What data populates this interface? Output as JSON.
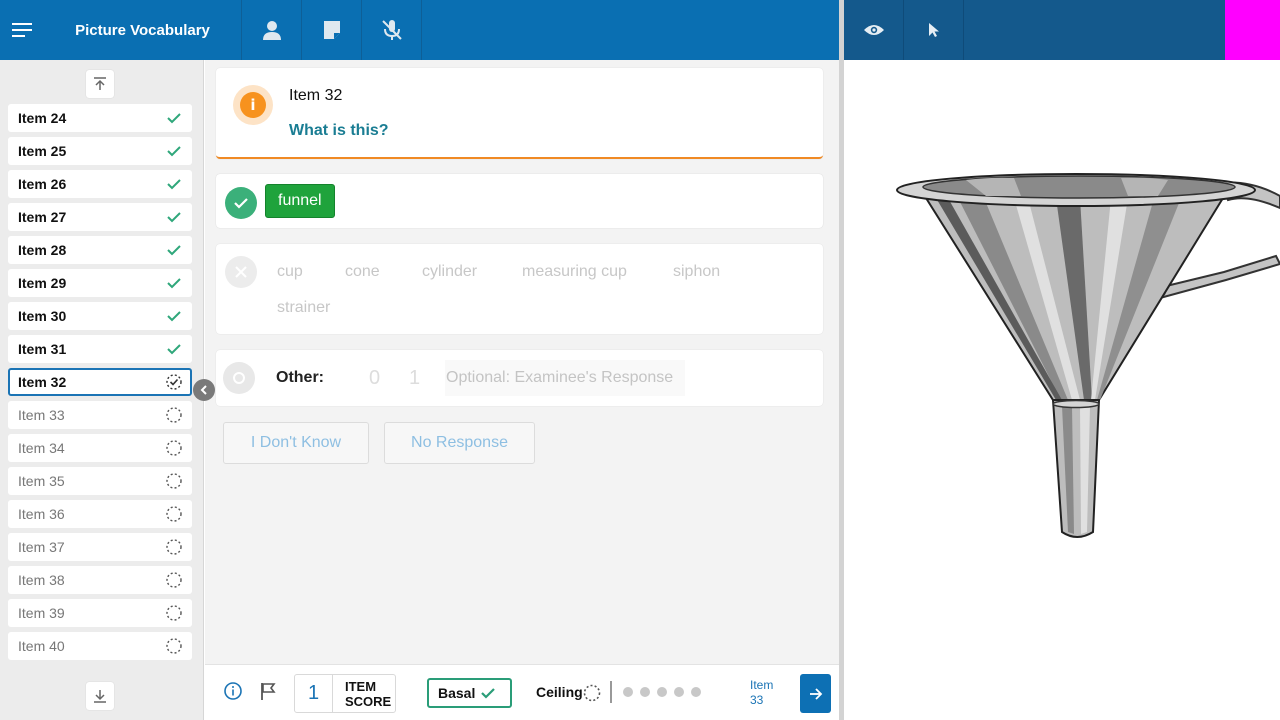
{
  "app": {
    "title": "Picture Vocabulary"
  },
  "sidebar": {
    "items": [
      {
        "label": "Item 24",
        "status": "done"
      },
      {
        "label": "Item 25",
        "status": "done"
      },
      {
        "label": "Item 26",
        "status": "done"
      },
      {
        "label": "Item 27",
        "status": "done"
      },
      {
        "label": "Item 28",
        "status": "done"
      },
      {
        "label": "Item 29",
        "status": "done"
      },
      {
        "label": "Item 30",
        "status": "done"
      },
      {
        "label": "Item 31",
        "status": "done"
      },
      {
        "label": "Item 32",
        "status": "current"
      },
      {
        "label": "Item 33",
        "status": "pending"
      },
      {
        "label": "Item 34",
        "status": "pending"
      },
      {
        "label": "Item 35",
        "status": "pending"
      },
      {
        "label": "Item 36",
        "status": "pending"
      },
      {
        "label": "Item 37",
        "status": "pending"
      },
      {
        "label": "Item 38",
        "status": "pending"
      },
      {
        "label": "Item 39",
        "status": "pending"
      },
      {
        "label": "Item 40",
        "status": "pending"
      }
    ]
  },
  "question": {
    "item_label": "Item 32",
    "prompt": "What is this?"
  },
  "answer": {
    "correct": "funnel"
  },
  "incorrect_options": [
    "cup",
    "cone",
    "cylinder",
    "measuring cup",
    "siphon",
    "strainer"
  ],
  "other": {
    "label": "Other:",
    "score_options": [
      "0",
      "1"
    ],
    "placeholder": "Optional: Examinee's Response"
  },
  "buttons": {
    "dont_know": "I Don't Know",
    "no_response": "No Response"
  },
  "bottom": {
    "item_score_value": "1",
    "item_score_label_1": "ITEM",
    "item_score_label_2": "SCORE",
    "basal_label": "Basal",
    "ceiling_label": "Ceiling",
    "next_item_line1": "Item",
    "next_item_line2": "33"
  },
  "colors": {
    "topbar": "#0a6fb2",
    "topbar_right": "#14598c",
    "accent_orange": "#f7921e",
    "correct_green": "#1fa33c",
    "check_green": "#3bb07a",
    "question_teal": "#1a7d93",
    "magenta_marker": "#ff00ff"
  },
  "icons": {
    "menu": "menu-icon",
    "examinee": "person-icon",
    "notes": "note-icon",
    "mic_off": "mic-off-icon",
    "preview": "eye-icon",
    "pointer": "cursor-icon"
  }
}
